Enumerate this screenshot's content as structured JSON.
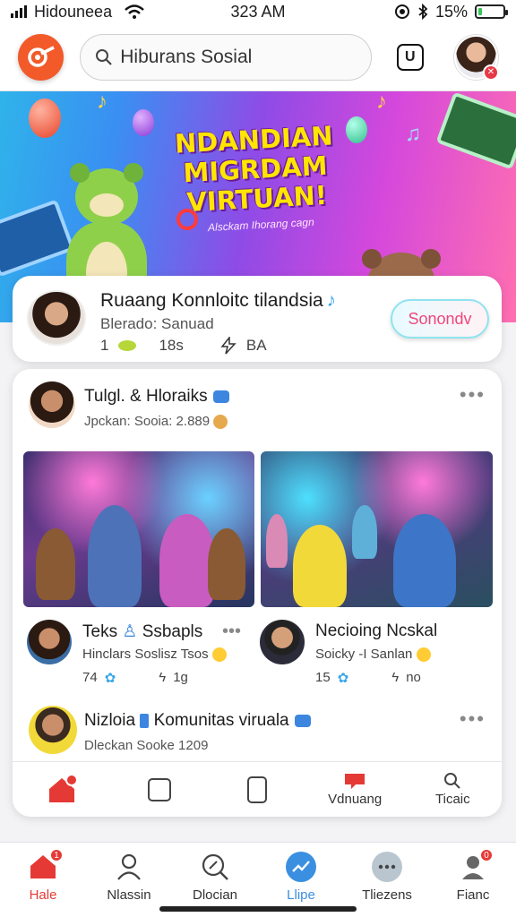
{
  "status_bar": {
    "carrier": "Hidouneea",
    "time": "323 AM",
    "battery": "15%",
    "battery_level": 0.15
  },
  "header": {
    "search_placeholder": "Hiburans Sosial"
  },
  "banner": {
    "title_lines": [
      "NDANDIAN",
      "MIGRDAM",
      "VIRTUAN!"
    ],
    "subtitle": "Alsckam Ihorang cagn"
  },
  "featured": {
    "name": "Ruaang Konnloitc tilandsia",
    "subtitle": "Blerado: Sanuad",
    "stat1": "1",
    "stat2": "18s",
    "stat3": "BA",
    "join_label": "Sonondv"
  },
  "feed": {
    "post": {
      "title": "Tulgl. & Hloraiks",
      "meta": "Jpckan: Sooia: 2.889"
    },
    "sub_posts": [
      {
        "title": "Teks",
        "title2": "Ssbapls",
        "meta": "Hinclars Soslisz Tsos",
        "count": "74",
        "stat": "1g"
      },
      {
        "title": "Necioing Ncskal",
        "meta": "Soicky -I Sanlan",
        "count": "15",
        "stat": "no"
      }
    ],
    "post2": {
      "title": "Nizloia",
      "title2": "Komunitas viruala",
      "meta": "Dleckan Sooke 1209"
    },
    "inner_tabs": [
      "",
      "",
      "",
      "Vdnuang",
      "Ticaic"
    ]
  },
  "bottom_nav": [
    {
      "label": "Hale",
      "icon": "home-icon",
      "badge": "1",
      "active": true
    },
    {
      "label": "Nlassin",
      "icon": "person-icon",
      "badge": "",
      "active": false
    },
    {
      "label": "Dlocian",
      "icon": "search-icon",
      "badge": "",
      "active": false
    },
    {
      "label": "Llipe",
      "icon": "trending-icon",
      "badge": "",
      "active": false
    },
    {
      "label": "Tliezens",
      "icon": "chat-icon",
      "badge": "",
      "active": false
    },
    {
      "label": "Fianc",
      "icon": "profile-icon",
      "badge": "0",
      "active": false
    }
  ],
  "colors": {
    "accent": "#f25a2a",
    "active_nav": "#e53935",
    "verified": "#3d86e0",
    "join_text": "#f0467a"
  }
}
